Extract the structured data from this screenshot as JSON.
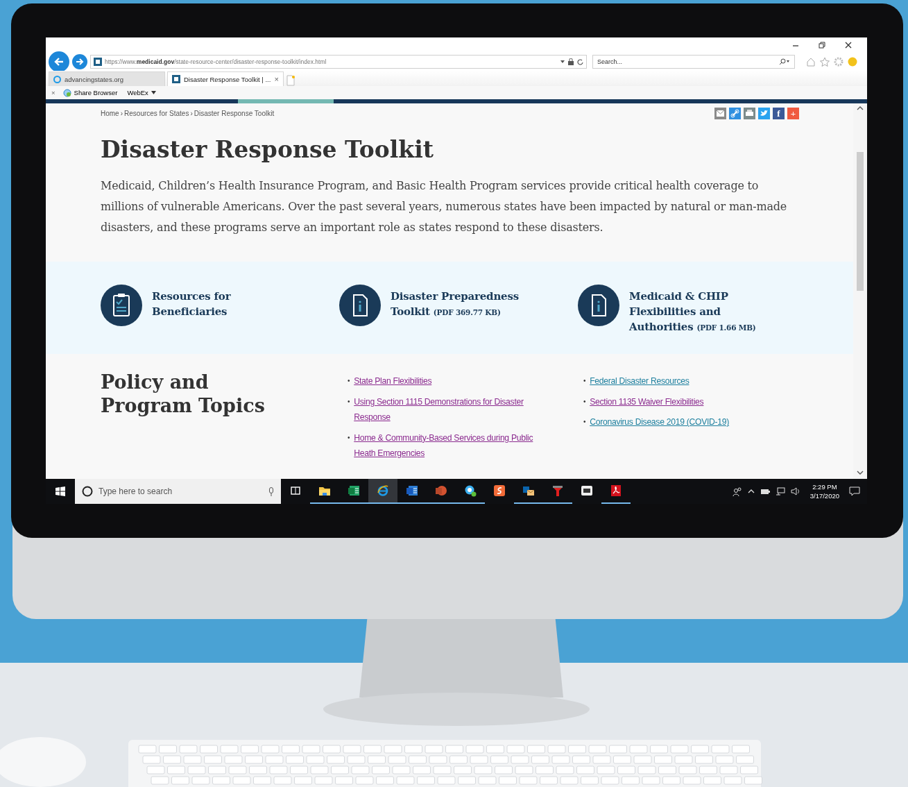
{
  "browser": {
    "address": "https://www.medicaid.gov/state-resource-center/disaster-response-toolkit/index.html",
    "search": {
      "placeholder": "Search..."
    },
    "tabs": [
      {
        "label": "advancingstates.org",
        "selected": false
      },
      {
        "label": "Disaster Response Toolkit | ...",
        "selected": true,
        "close": "×"
      }
    ],
    "command_bar": {
      "close": "×",
      "items": [
        {
          "kind": "share",
          "label": "Share Browser"
        },
        {
          "kind": "menu",
          "label": "WebEx"
        }
      ]
    }
  },
  "page": {
    "breadcrumb": [
      {
        "label": "Home"
      },
      {
        "separator": "›",
        "label": "Resources for States"
      },
      {
        "separator": "›",
        "label": "Disaster Response Toolkit"
      }
    ],
    "share_buttons": [
      {
        "kind": "email",
        "color": "#8a8a8a"
      },
      {
        "kind": "link",
        "color": "#2f8fe0"
      },
      {
        "kind": "print",
        "color": "#7d8c8c"
      },
      {
        "kind": "bird",
        "color": "#2aa3ef"
      },
      {
        "kind": "letter",
        "glyph": "f",
        "color": "#3b5998"
      },
      {
        "kind": "letter",
        "glyph": "+",
        "color": "#f05a40"
      }
    ],
    "title": "Disaster Response Toolkit",
    "intro": "Medicaid, Children’s Health Insurance Program, and Basic Health Program services provide critical health coverage to millions of vulnerable Americans. Over the past several years, numerous states have been impacted by natural or man-made disasters, and these programs serve an important role as states respond to these disasters.",
    "resources": [
      {
        "kind": "clipboard",
        "label": "Resources for Beneficiaries"
      },
      {
        "kind": "document",
        "label": "Disaster Preparedness Toolkit",
        "note": "(PDF 369.77 KB)"
      },
      {
        "kind": "document",
        "label": "Medicaid & CHIP Flexibilities and Authorities",
        "note": "(PDF 1.66 MB)"
      }
    ],
    "topics": {
      "heading": "Policy and Program Topics",
      "columns": [
        [
          {
            "bullet": "•",
            "label": "State Plan Flexibilities",
            "visited": true
          },
          {
            "bullet": "•",
            "label": "Using Section 1115 Demonstrations for Disaster Response",
            "visited": true
          },
          {
            "bullet": "•",
            "label": "Home & Community-Based Services during Public Heath Emergencies",
            "visited": true
          }
        ],
        [
          {
            "bullet": "•",
            "label": "Federal Disaster Resources",
            "visited": false
          },
          {
            "bullet": "•",
            "label": "Section 1135 Waiver Flexibilities",
            "visited": true
          },
          {
            "bullet": "•",
            "label": "Coronavirus Disease 2019 (COVID-19)",
            "visited": false
          }
        ]
      ]
    }
  },
  "taskbar": {
    "search": {
      "placeholder": "Type here to search"
    },
    "apps": [
      {
        "kind": "taskview",
        "running": false,
        "selected": false
      },
      {
        "kind": "folder",
        "running": true,
        "selected": false
      },
      {
        "kind": "spreadsheet",
        "running": true,
        "selected": false
      },
      {
        "kind": "browser",
        "running": true,
        "selected": true
      },
      {
        "kind": "document",
        "running": true,
        "selected": false
      },
      {
        "kind": "presentation",
        "running": true,
        "selected": false
      },
      {
        "kind": "chat",
        "running": true,
        "selected": false
      },
      {
        "kind": "swirl",
        "running": false,
        "selected": false
      },
      {
        "kind": "mail",
        "running": true,
        "selected": false
      },
      {
        "kind": "tool",
        "running": true,
        "selected": false
      },
      {
        "kind": "camera",
        "running": false,
        "selected": false
      },
      {
        "kind": "pdf",
        "running": true,
        "selected": false
      }
    ],
    "clock": {
      "time": "2:29 PM",
      "date": "3/17/2020"
    }
  }
}
